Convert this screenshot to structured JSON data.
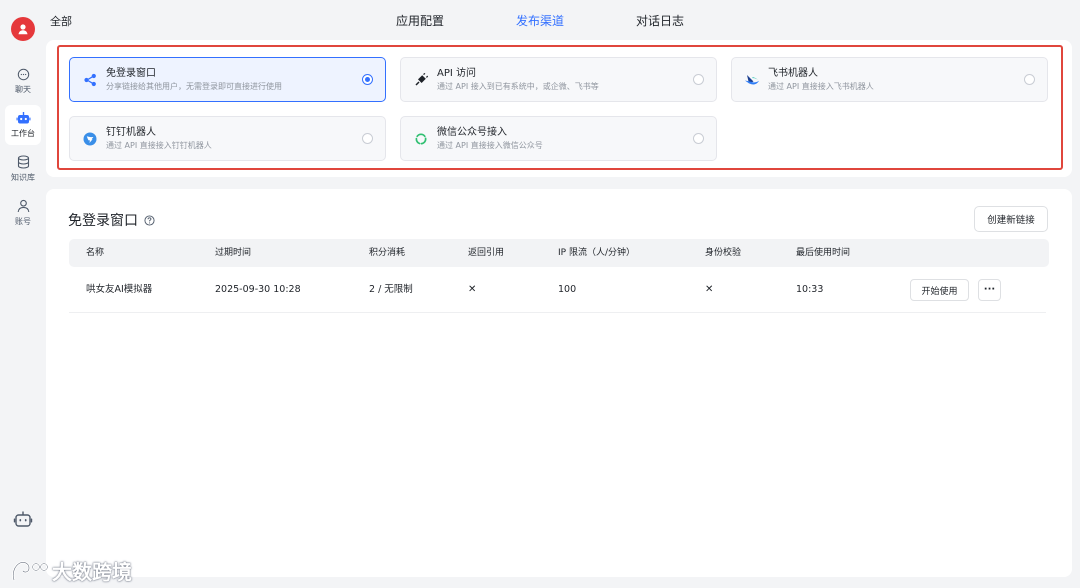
{
  "breadcrumb": "全部",
  "sidebar": {
    "items": [
      {
        "label": "聊天",
        "icon": "chat-icon"
      },
      {
        "label": "工作台",
        "icon": "robot-icon"
      },
      {
        "label": "知识库",
        "icon": "database-icon"
      },
      {
        "label": "账号",
        "icon": "user-icon"
      }
    ],
    "active": "工作台"
  },
  "tabs": [
    {
      "label": "应用配置"
    },
    {
      "label": "发布渠道"
    },
    {
      "label": "对话日志"
    }
  ],
  "active_tab": "发布渠道",
  "channels": [
    {
      "title": "免登录窗口",
      "desc": "分享链接给其他用户，无需登录即可直接进行使用",
      "icon": "share-icon",
      "selected": true
    },
    {
      "title": "API 访问",
      "desc": "通过 API 接入到已有系统中，或企微、飞书等",
      "icon": "api-plug-icon",
      "selected": false
    },
    {
      "title": "飞书机器人",
      "desc": "通过 API 直接接入飞书机器人",
      "icon": "feishu-icon",
      "selected": false
    },
    {
      "title": "钉钉机器人",
      "desc": "通过 API 直接接入钉钉机器人",
      "icon": "dingtalk-icon",
      "selected": false
    },
    {
      "title": "微信公众号接入",
      "desc": "通过 API 直接接入微信公众号",
      "icon": "wechat-icon",
      "selected": false
    }
  ],
  "section": {
    "title": "免登录窗口",
    "create_label": "创建新链接"
  },
  "table": {
    "headers": [
      "名称",
      "过期时间",
      "积分消耗",
      "返回引用",
      "IP 限流（人/分钟）",
      "身份校验",
      "最后使用时间"
    ],
    "rows": [
      {
        "name": "哄女友AI模拟器",
        "expire": "2025-09-30 10:28",
        "points": "2 / 无限制",
        "citation": "✕",
        "ip_limit": "100",
        "auth": "✕",
        "last_used": "10:33",
        "start_label": "开始使用",
        "more_label": "···"
      }
    ]
  },
  "watermark": "大数跨境",
  "colors": {
    "accent": "#3370ff",
    "highlight_border": "#e0463c",
    "avatar": "#e5383b"
  }
}
